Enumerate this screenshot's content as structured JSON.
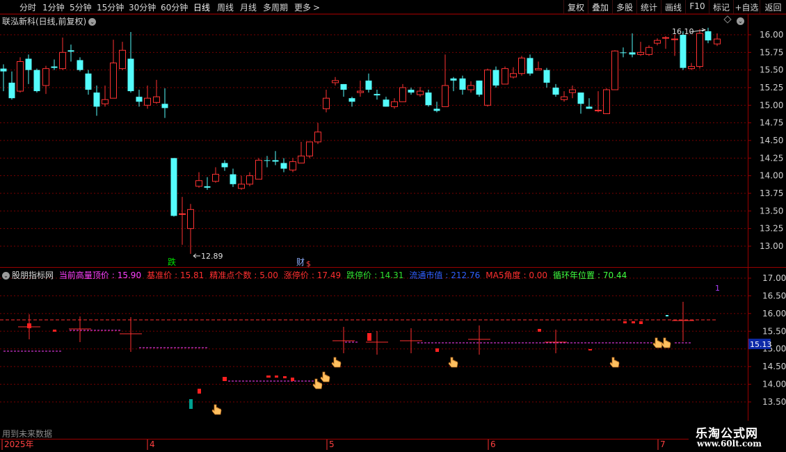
{
  "toolbar": {
    "periods": [
      "分时",
      "1分钟",
      "5分钟",
      "15分钟",
      "30分钟",
      "60分钟",
      "日线",
      "周线",
      "月线",
      "多周期",
      "更多"
    ],
    "active_period": "日线",
    "right_buttons": [
      "复权",
      "叠加",
      "多股",
      "统计",
      "画线",
      "F10",
      "标记",
      "+自选",
      "返回"
    ]
  },
  "main_chart": {
    "title": "联泓新科(日线,前复权)",
    "price_axis_labels": [
      "16.00",
      "15.75",
      "15.50",
      "15.25",
      "15.00",
      "14.75",
      "14.50",
      "14.25",
      "14.00",
      "13.75",
      "13.50",
      "13.25",
      "13.00"
    ],
    "high_annotation": "16.10",
    "low_annotation": "12.89",
    "event_markers": [
      {
        "text": "跌",
        "color": "#00e000"
      },
      {
        "text": "财",
        "color": "#8fb0ff"
      },
      {
        "text": "$",
        "color": "#ff4040"
      }
    ]
  },
  "indicator": {
    "name": "股朋指标网",
    "fields": [
      {
        "label": "当前高量顶价",
        "value": "15.90",
        "color": "#ff40ff"
      },
      {
        "label": "基准价",
        "value": "15.81",
        "color": "#ff3030"
      },
      {
        "label": "精准点个数",
        "value": "5.00",
        "color": "#ff3030"
      },
      {
        "label": "涨停价",
        "value": "17.49",
        "color": "#ff3030"
      },
      {
        "label": "跌停价",
        "value": "14.31",
        "color": "#30e030"
      },
      {
        "label": "流通市值",
        "value": "212.76",
        "color": "#3060ff"
      },
      {
        "label": "MA5角度",
        "value": "0.00",
        "color": "#ff3030"
      },
      {
        "label": "循环年位置",
        "value": "70.44",
        "color": "#40ff40"
      }
    ],
    "axis_labels": [
      "17.00",
      "16.50",
      "16.00",
      "15.50",
      "15.00",
      "14.50",
      "14.00",
      "13.50"
    ],
    "current_value_tag": "15.13",
    "corner_marker": "1",
    "future_note": "用到未来数据"
  },
  "time_axis": {
    "labels": [
      "2025年",
      "4",
      "5",
      "6",
      "7"
    ]
  },
  "watermark": {
    "site_name": "乐淘公式网",
    "url": "www.60lt.com"
  },
  "colors": {
    "up": "#ff3232",
    "down": "#54fcfc",
    "grid": "#7a0000",
    "axis_text": "#d0d0d0"
  }
}
